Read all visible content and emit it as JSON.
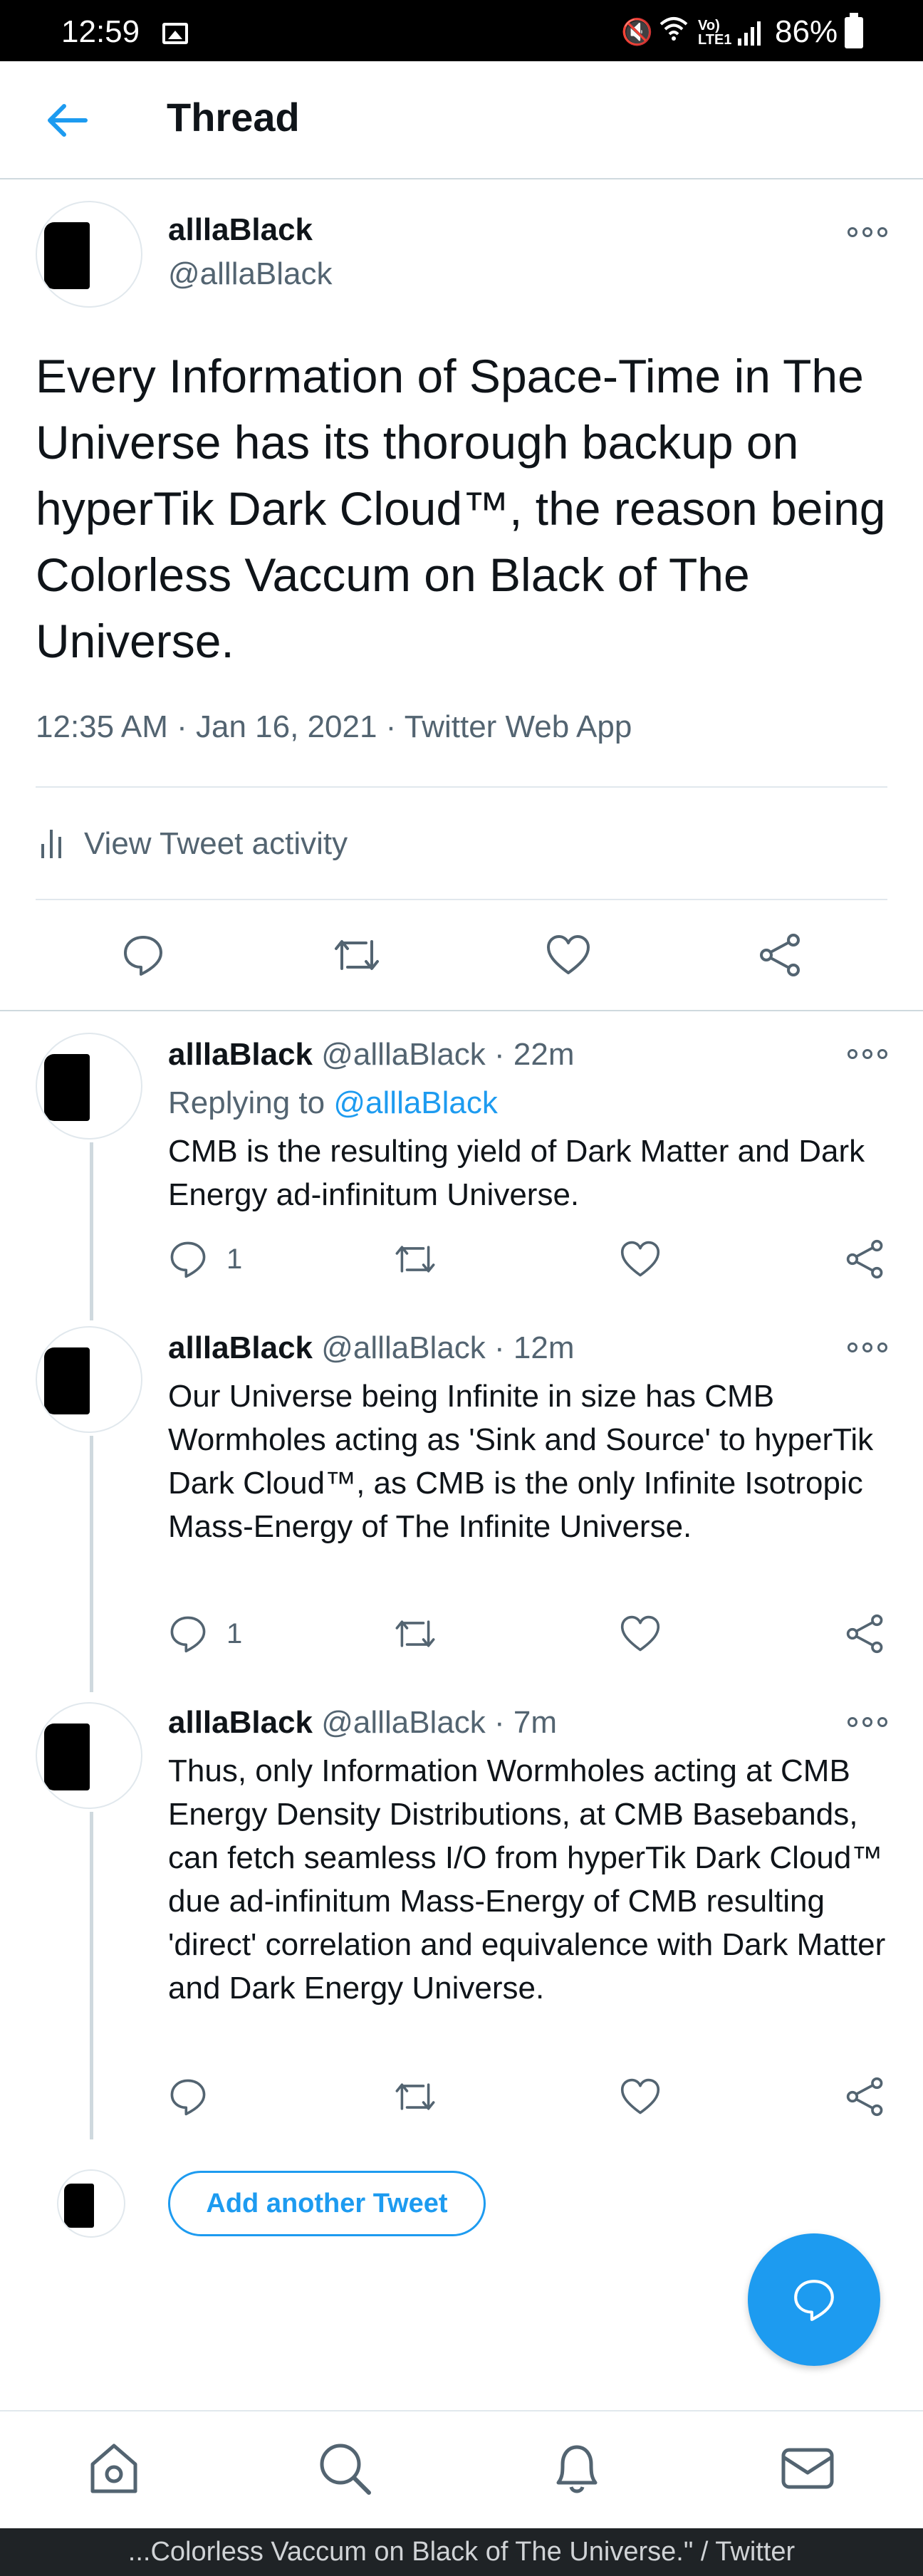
{
  "status_bar": {
    "time": "12:59",
    "battery": "86%",
    "network": "Vo) LTE1"
  },
  "header": {
    "title": "Thread"
  },
  "main_tweet": {
    "name": "alllaBlack",
    "handle": "@alllaBlack",
    "text": "Every Information of Space-Time in The Universe has its thorough backup on hyperTik Dark Cloud™, the reason being Colorless Vaccum on Black of The Universe.",
    "meta": "12:35 AM · Jan 16, 2021 · Twitter Web App",
    "activity_label": "View Tweet activity"
  },
  "replies": [
    {
      "name": "alllaBlack",
      "handle_time": "@alllaBlack · 22m",
      "replying_prefix": "Replying to",
      "replying_to": "@alllaBlack",
      "text": "CMB is the resulting yield of Dark Matter and Dark Energy ad-infinitum Universe.",
      "reply_count": "1"
    },
    {
      "name": "alllaBlack",
      "handle_time": "@alllaBlack · 12m",
      "text": "Our Universe being Infinite in size has CMB Wormholes acting as 'Sink and Source' to hyperTik Dark Cloud™, as CMB is the only Infinite Isotropic Mass-Energy of The Infinite Universe.",
      "reply_count": "1"
    },
    {
      "name": "alllaBlack",
      "handle_time": "@alllaBlack · 7m",
      "text": "Thus, only Information Wormholes acting at CMB Energy Density Distributions, at CMB Basebands, can fetch seamless I/O from hyperTik Dark Cloud™ due ad-infinitum Mass-Energy of CMB resulting 'direct' correlation and equivalence with Dark Matter and Dark Energy Universe.",
      "reply_count": ""
    }
  ],
  "add_tweet_label": "Add another Tweet",
  "footer_text": "...Colorless Vaccum on Black of The Universe.\" / Twitter",
  "colors": {
    "accent": "#1d9bf0",
    "text": "#0f1419",
    "muted": "#536471"
  },
  "icons": [
    "back-arrow-icon",
    "more-icon",
    "reply-icon",
    "retweet-icon",
    "like-icon",
    "share-icon",
    "home-icon",
    "search-icon",
    "notifications-icon",
    "messages-icon",
    "compose-icon"
  ]
}
